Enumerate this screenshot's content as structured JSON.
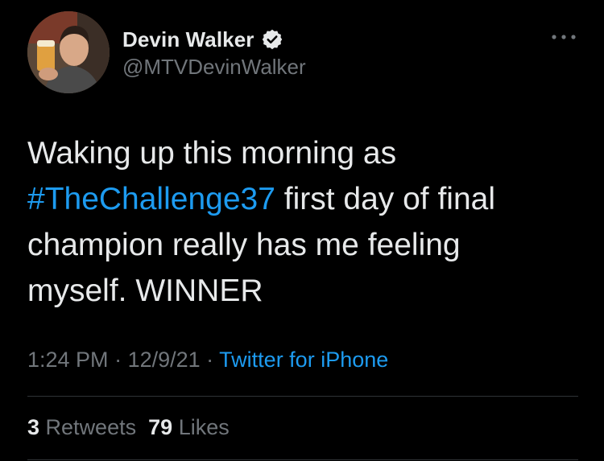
{
  "author": {
    "display_name": "Devin Walker",
    "handle": "@MTVDevinWalker",
    "verified_icon": "verified-badge-icon"
  },
  "tweet": {
    "text_part1": "Waking up this morning as\n",
    "hashtag": "#TheChallenge37",
    "text_part2": " first day of final\nchampion really has me feeling\nmyself. WINNER"
  },
  "meta": {
    "time": "1:24 PM",
    "separator1": " · ",
    "date": "12/9/21",
    "separator2": " · ",
    "source": "Twitter for iPhone"
  },
  "stats": {
    "retweets_count": "3",
    "retweets_label": "Retweets",
    "likes_count": "79",
    "likes_label": "Likes"
  },
  "colors": {
    "background": "#000000",
    "accent": "#1d9bf0",
    "text": "#e7e9ea",
    "muted": "#71767b"
  },
  "icons": {
    "more": "more-options-icon"
  }
}
